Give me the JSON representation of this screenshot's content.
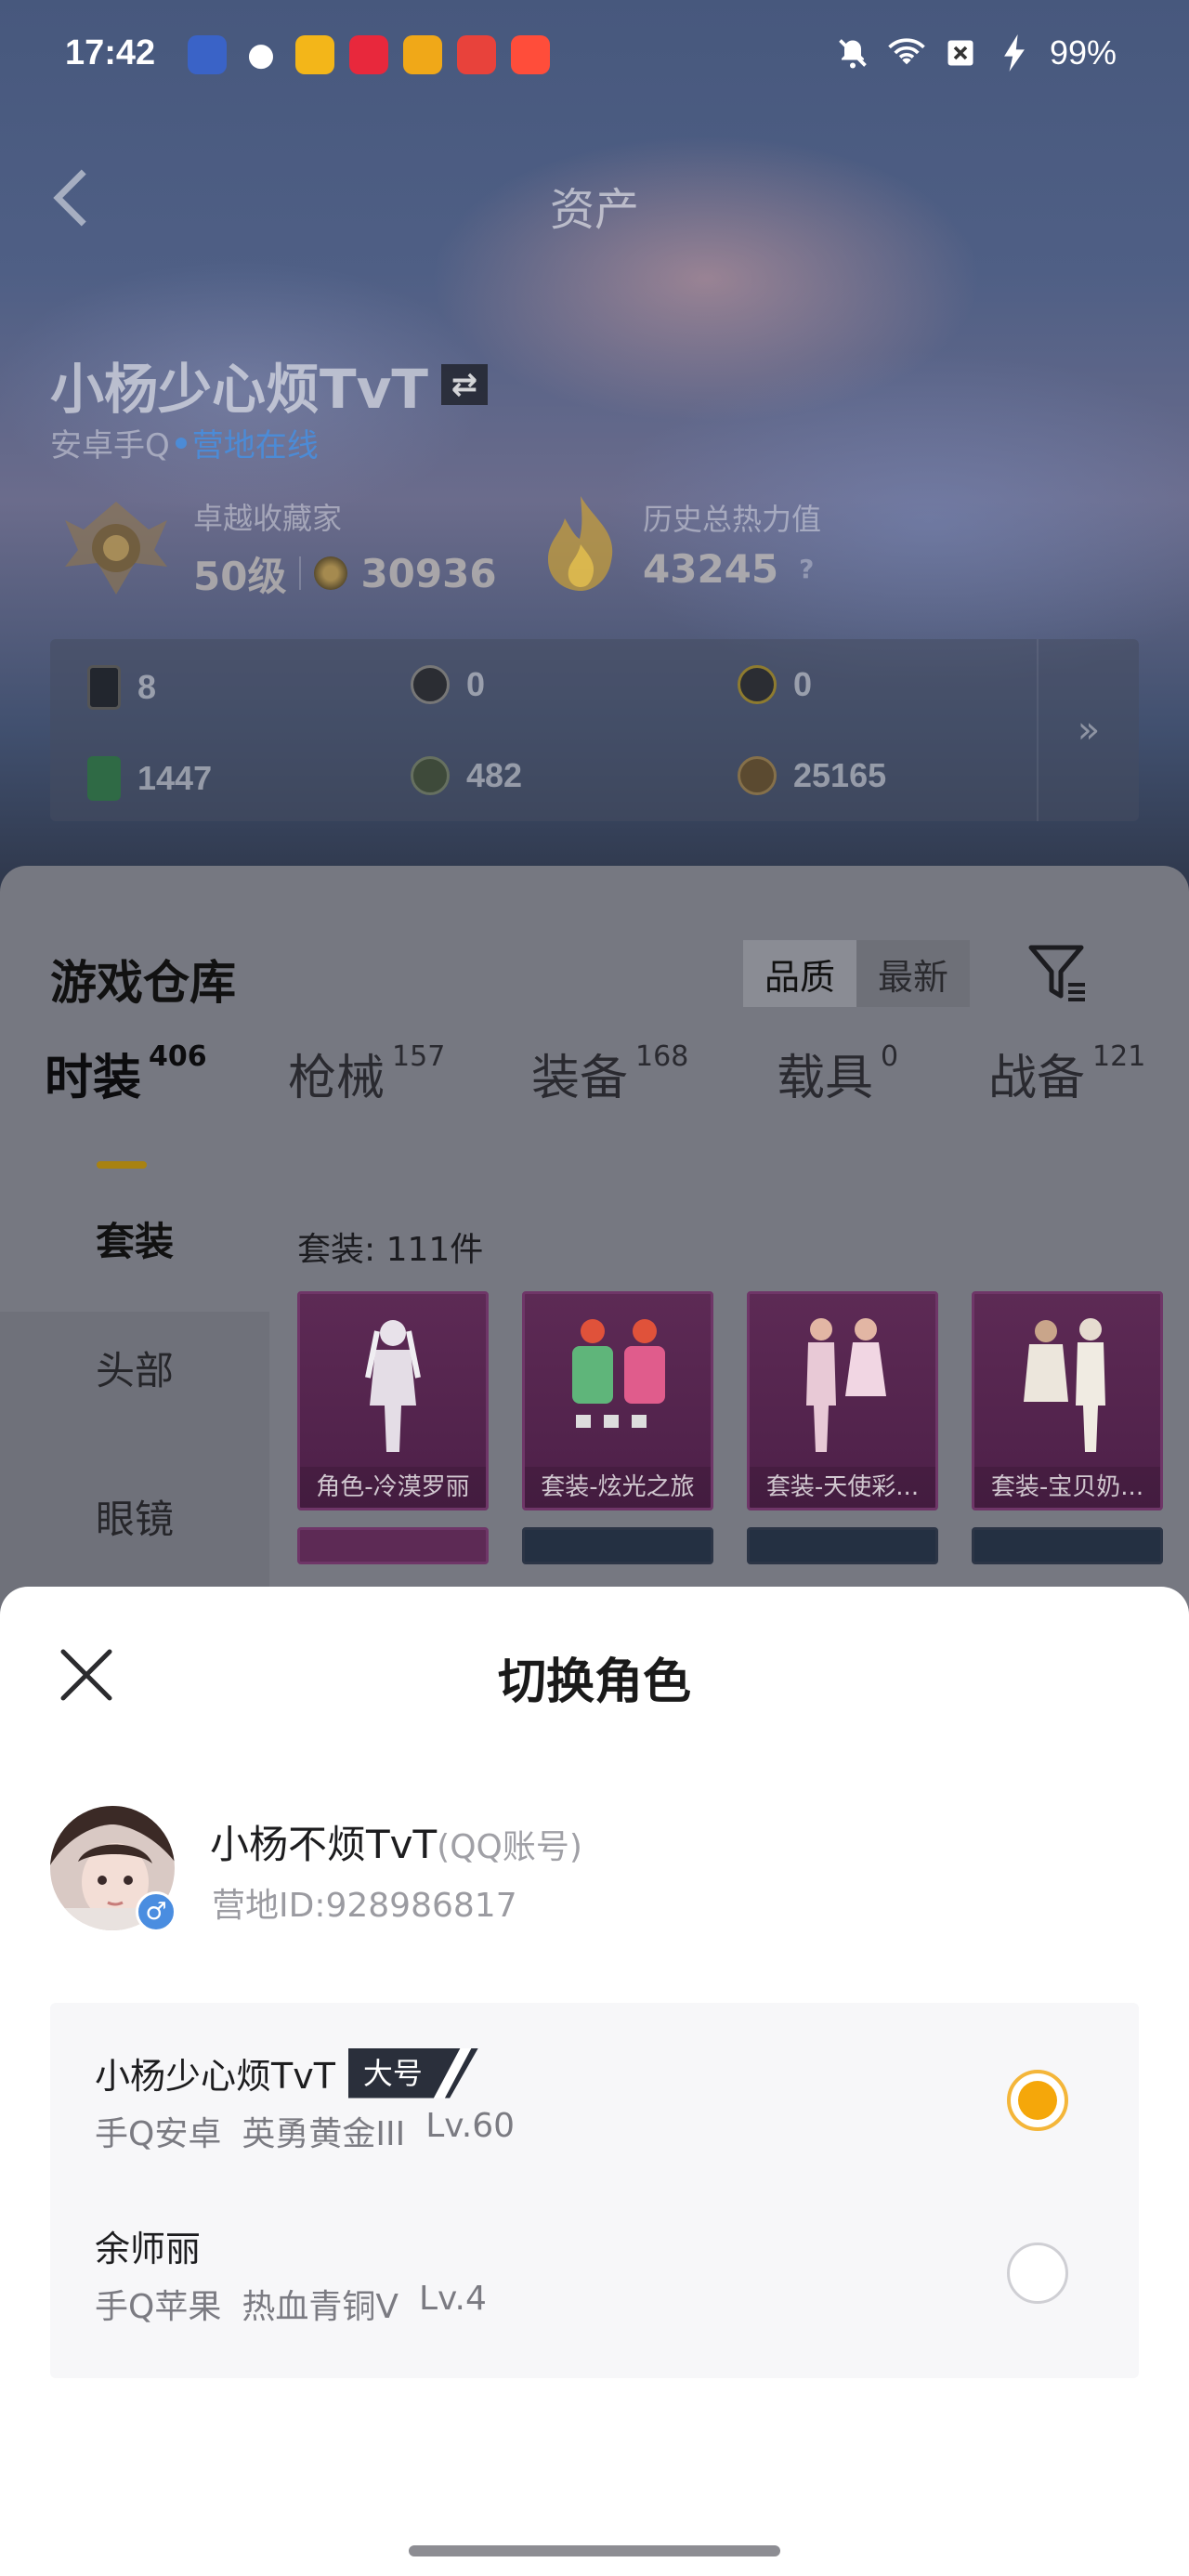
{
  "status_bar": {
    "time": "17:42",
    "battery": "99%",
    "apps": [
      "#3a63c7",
      "#09b83e",
      "#f3b619",
      "#e8283c",
      "#f0a818",
      "#e8423b",
      "#ff4d3a"
    ],
    "icons": [
      "mute-bell-icon",
      "wifi-icon",
      "sim-off-icon",
      "charging-icon"
    ]
  },
  "nav": {
    "back_icon": "chevron-left-icon",
    "title": "资产"
  },
  "player": {
    "name": "小杨少心烦TvT",
    "platform": "安卓手Q",
    "status": "营地在线",
    "rank_title": "卓越收藏家",
    "level": "50级",
    "collect_points": "30936",
    "heat_title": "历史总热力值",
    "heat_value": "43245",
    "heat_help": "?"
  },
  "assets": [
    {
      "icon": "card-icon",
      "value": "8"
    },
    {
      "icon": "silver-coin-icon",
      "value": "0"
    },
    {
      "icon": "gold-coin-icon",
      "value": "0"
    },
    {
      "icon": "green-ticket-icon",
      "value": "1447"
    },
    {
      "icon": "dark-coin-icon",
      "value": "482"
    },
    {
      "icon": "bronze-coin-icon",
      "value": "25165"
    }
  ],
  "assets_more": "»",
  "warehouse": {
    "title": "游戏仓库",
    "sort": [
      "品质",
      "最新"
    ],
    "tabs": [
      {
        "label": "时装",
        "count": "406"
      },
      {
        "label": "枪械",
        "count": "157"
      },
      {
        "label": "装备",
        "count": "168"
      },
      {
        "label": "载具",
        "count": "0"
      },
      {
        "label": "战备",
        "count": "121"
      }
    ],
    "side": [
      "套装",
      "头部",
      "眼镜"
    ],
    "caption": "套装: 111件",
    "items": [
      "角色-冷漠罗丽",
      "套装-炫光之旅",
      "套装-天使彩...",
      "套装-宝贝奶..."
    ]
  },
  "modal": {
    "title": "切换角色",
    "account_name": "小杨不烦TvT",
    "account_type": "(QQ账号)",
    "camp_id": "营地ID:928986817",
    "gender": "♂",
    "roles": [
      {
        "name": "小杨少心烦TvT",
        "tag": "大号",
        "platform": "手Q安卓",
        "rank": "英勇黄金III",
        "level": "Lv.60",
        "selected": true
      },
      {
        "name": "余师丽",
        "tag": "",
        "platform": "手Q苹果",
        "rank": "热血青铜V",
        "level": "Lv.4",
        "selected": false
      }
    ]
  }
}
